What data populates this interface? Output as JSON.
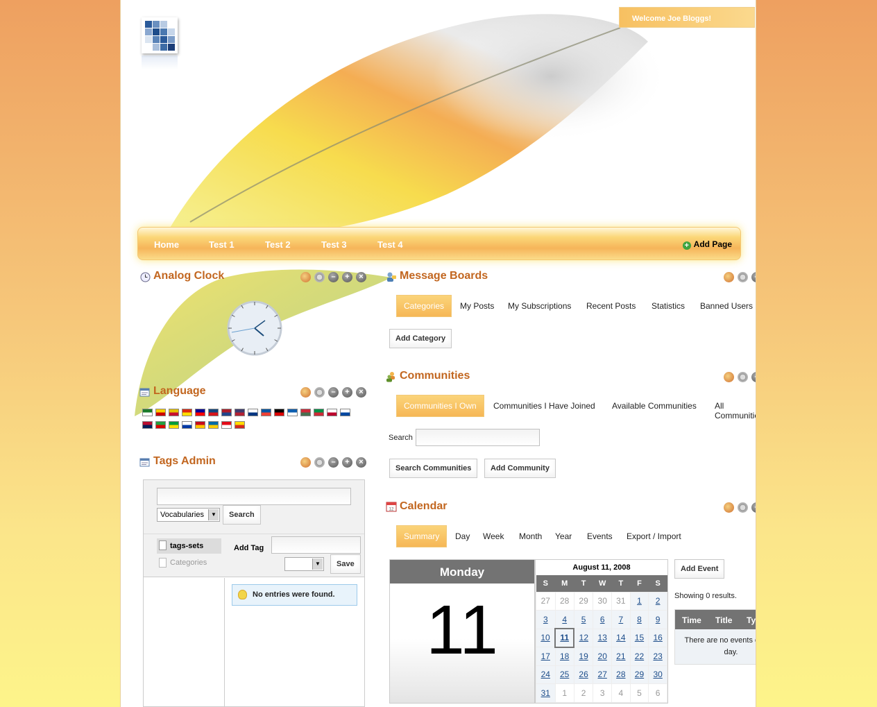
{
  "header": {
    "welcome": "Welcome Joe Bloggs!"
  },
  "nav": {
    "items": [
      "Home",
      "Test 1",
      "Test 2",
      "Test 3",
      "Test 4"
    ],
    "add_page": "Add Page"
  },
  "analog_clock": {
    "title": "Analog Clock",
    "time": "10:14"
  },
  "language": {
    "title": "Language",
    "flags_row1": [
      "Arabic",
      "Catalan",
      "Catalan-ES",
      "Chinese",
      "Chinese-TW",
      "Czech",
      "Dutch",
      "English",
      "Finnish",
      "French",
      "German",
      "Greek",
      "Hungarian",
      "Italian",
      "Japanese",
      "Korean"
    ],
    "flags_row2": [
      "Norwegian",
      "Persian",
      "Portuguese",
      "Russian",
      "Spanish",
      "Swedish",
      "Turkish",
      "Vietnamese"
    ]
  },
  "tags_admin": {
    "title": "Tags Admin",
    "vocab_select": "Vocabularies",
    "search_button": "Search",
    "sets": [
      "tags-sets",
      "Categories"
    ],
    "add_tag_label": "Add Tag",
    "save_button": "Save",
    "no_entries": "No entries were found."
  },
  "message_boards": {
    "title": "Message Boards",
    "tabs": [
      "Categories",
      "My Posts",
      "My Subscriptions",
      "Recent Posts",
      "Statistics",
      "Banned Users"
    ],
    "add_category": "Add Category"
  },
  "communities": {
    "title": "Communities",
    "tabs": [
      "Communities I Own",
      "Communities I Have Joined",
      "Available Communities",
      "All Communities"
    ],
    "search_label": "Search",
    "search_button": "Search Communities",
    "add_button": "Add Community"
  },
  "calendar": {
    "title": "Calendar",
    "tabs": [
      "Summary",
      "Day",
      "Week",
      "Month",
      "Year",
      "Events",
      "Export / Import"
    ],
    "weekday": "Monday",
    "day": "11",
    "month_title": "August 11, 2008",
    "dow": [
      "S",
      "M",
      "T",
      "W",
      "T",
      "F",
      "S"
    ],
    "weeks": [
      [
        "27",
        "28",
        "29",
        "30",
        "31",
        "1",
        "2"
      ],
      [
        "3",
        "4",
        "5",
        "6",
        "7",
        "8",
        "9"
      ],
      [
        "10",
        "11",
        "12",
        "13",
        "14",
        "15",
        "16"
      ],
      [
        "17",
        "18",
        "19",
        "20",
        "21",
        "22",
        "23"
      ],
      [
        "24",
        "25",
        "26",
        "27",
        "28",
        "29",
        "30"
      ],
      [
        "31",
        "1",
        "2",
        "3",
        "4",
        "5",
        "6"
      ]
    ],
    "add_event": "Add Event",
    "showing": "Showing 0 results.",
    "columns": [
      "Time",
      "Title",
      "Type"
    ],
    "empty": "There are no events on this day."
  },
  "colors": {
    "accent": "#c2661f",
    "nav_gradient": "#f6b55a",
    "header_gray": "#737373",
    "link": "#1d4d8a"
  }
}
